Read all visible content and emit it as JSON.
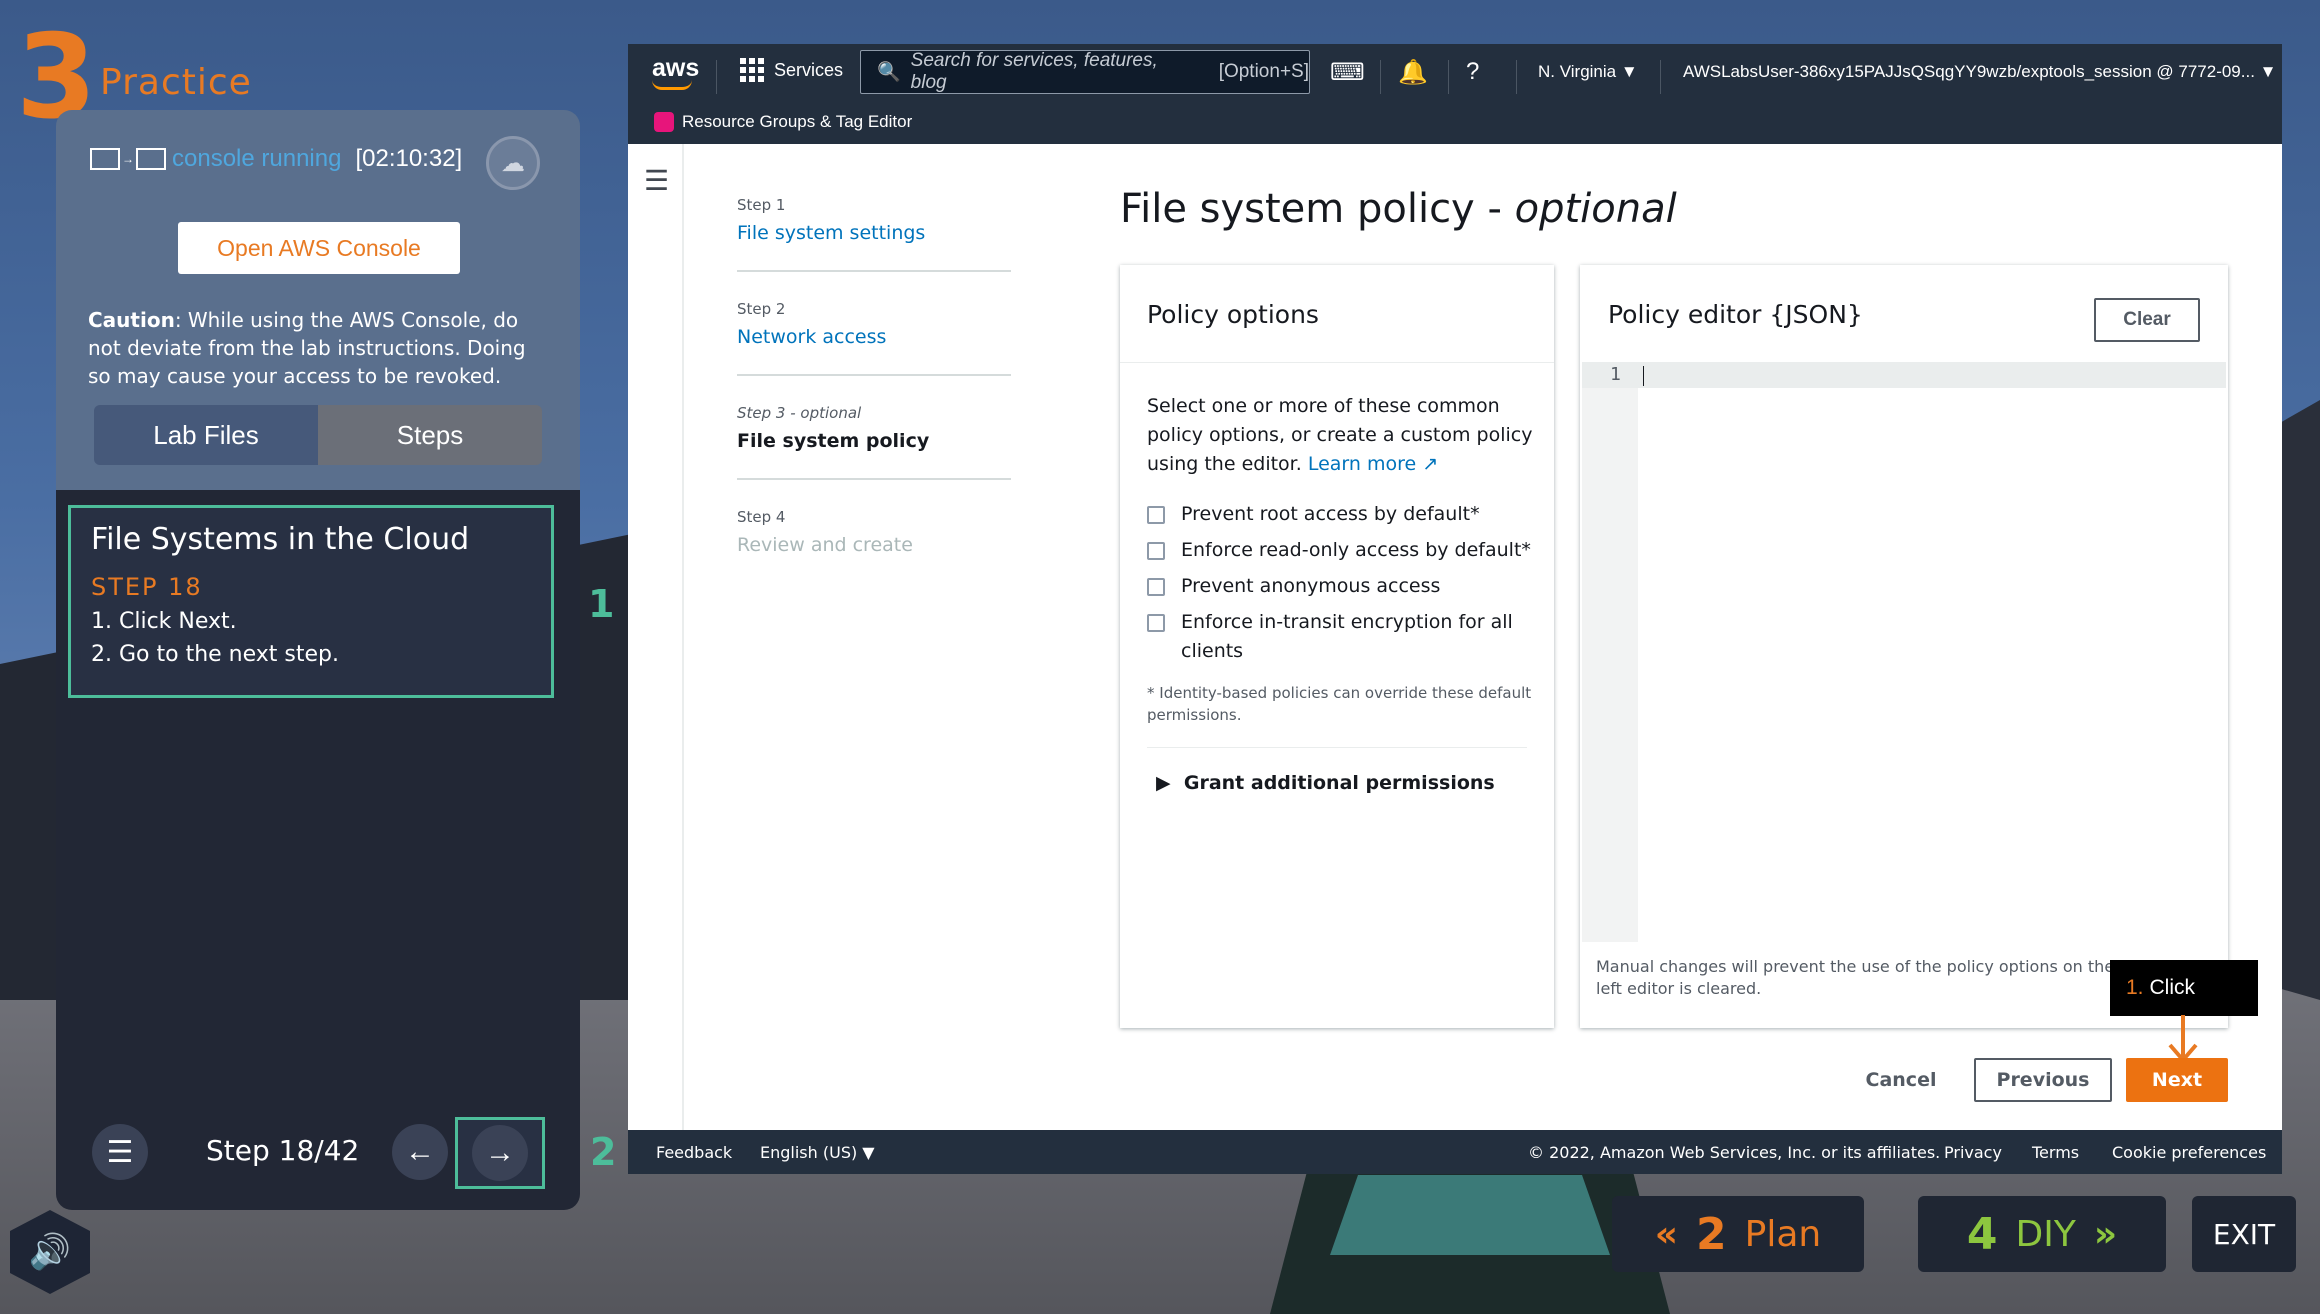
{
  "practice": {
    "number": "3",
    "title": "Practice"
  },
  "console": {
    "status": "console running",
    "timer": "[02:10:32]"
  },
  "open_console_label": "Open AWS Console",
  "caution": {
    "label": "Caution",
    "text": ": While using the AWS Console, do not deviate from the lab instructions. Doing so may cause your access to be revoked."
  },
  "tabs": {
    "lab_files": "Lab Files",
    "steps": "Steps"
  },
  "step_card": {
    "title": "File Systems in the Cloud",
    "step": "STEP 18",
    "lines": [
      "1. Click Next.",
      "2. Go to the next step."
    ]
  },
  "markers": {
    "one": "1",
    "two": "2"
  },
  "nav": {
    "step_count": "Step 18/42"
  },
  "aws": {
    "logo": "aws",
    "services": "Services",
    "search_placeholder": "Search for services, features, blog",
    "search_shortcut": "[Option+S]",
    "region": "N. Virginia ▼",
    "user": "AWSLabsUser-386xy15PAJJsQSqgYY9wzb/exptools_session @ 7772-09... ▼",
    "favorite": "Resource Groups & Tag Editor"
  },
  "wizard": {
    "steps": [
      {
        "label": "Step 1",
        "name": "File system settings"
      },
      {
        "label": "Step 2",
        "name": "Network access"
      },
      {
        "label": "Step 3 - optional",
        "name": "File system policy"
      },
      {
        "label": "Step 4",
        "name": "Review and create"
      }
    ],
    "title_main": "File system policy - ",
    "title_italic": "optional"
  },
  "policy_options": {
    "header": "Policy options",
    "description": "Select one or more of these common policy options, or create a custom policy using the editor.",
    "learn_more": "Learn more",
    "checkboxes": [
      "Prevent root access by default*",
      "Enforce read-only access by default*",
      "Prevent anonymous access",
      "Enforce in-transit encryption for all clients"
    ],
    "note": "* Identity-based policies can override these default permissions.",
    "grant": "Grant additional permissions"
  },
  "policy_editor": {
    "header": "Policy editor {JSON}",
    "clear": "Clear",
    "line_number": "1",
    "note": "Manual changes will prevent the use of the policy options on the left editor is cleared."
  },
  "tooltip": {
    "num": "1.",
    "text": "Click"
  },
  "actions": {
    "cancel": "Cancel",
    "previous": "Previous",
    "next": "Next"
  },
  "footer": {
    "feedback": "Feedback",
    "language": "English (US) ▼",
    "copyright": "© 2022, Amazon Web Services, Inc. or its affiliates.",
    "privacy": "Privacy",
    "terms": "Terms",
    "cookies": "Cookie preferences"
  },
  "bottom": {
    "plan_num": "2",
    "plan": "Plan",
    "diy_num": "4",
    "diy": "DIY",
    "exit": "EXIT"
  },
  "colors": {
    "accent": "#e87a23",
    "aws_orange": "#ec7211",
    "highlight": "#4dbd9a",
    "link": "#0073bb"
  }
}
